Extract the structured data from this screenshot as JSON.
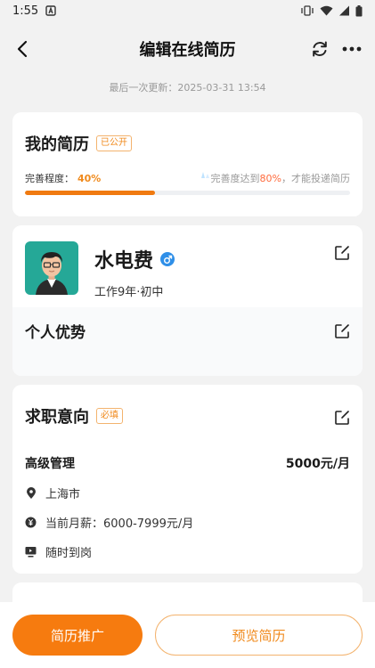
{
  "status_bar": {
    "time": "1:55"
  },
  "nav": {
    "title": "编辑在线简历"
  },
  "update_text": "最后一次更新：2025-03-31 13:54",
  "resume_card": {
    "title": "我的简历",
    "badge": "已公开",
    "progress_label": "完善程度：",
    "progress_value": "40%",
    "progress_fraction": 0.4,
    "hint_prefix": "完善度达到",
    "hint_highlight": "80%",
    "hint_suffix": "，才能投递简历"
  },
  "profile": {
    "name": "水电费",
    "gender_symbol": "♂",
    "meta": "工作9年·初中",
    "advantage_title": "个人优势"
  },
  "intent": {
    "title": "求职意向",
    "badge": "必填",
    "job_title": "高级管理",
    "salary": "5000元/月",
    "location": "上海市",
    "current_salary": "当前月薪：6000-7999元/月",
    "availability": "随时到岗"
  },
  "bottom": {
    "promote_label": "简历推广",
    "preview_label": "预览简历"
  },
  "colors": {
    "accent": "#f67b0f",
    "gender_blue": "#2f8fe8",
    "background": "#f2f2f2"
  }
}
